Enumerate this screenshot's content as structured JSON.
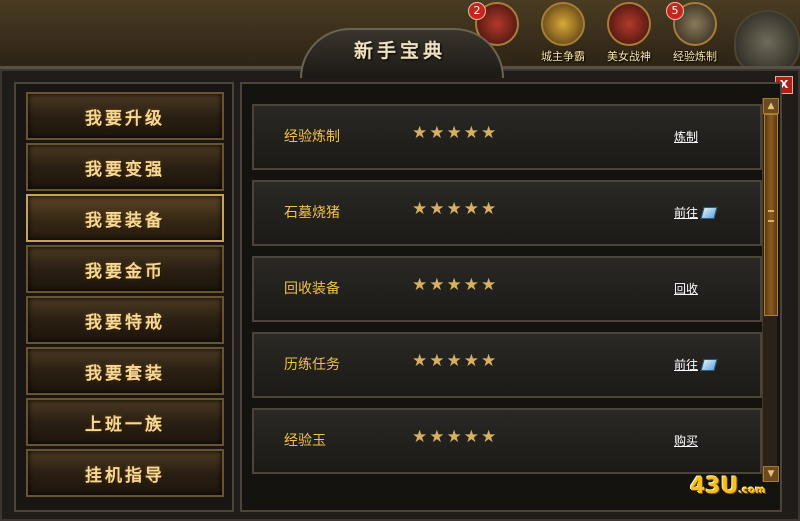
{
  "title": "新手宝典",
  "close_label": "X",
  "top_icons": [
    {
      "label": "",
      "badge": "2",
      "icon": "helmet-icon",
      "style": "red"
    },
    {
      "label": "城主争霸",
      "badge": "",
      "icon": "crown-helmet-icon",
      "style": "gold"
    },
    {
      "label": "美女战神",
      "badge": "",
      "icon": "warrior-woman-icon",
      "style": "red"
    },
    {
      "label": "经验炼制",
      "badge": "5",
      "icon": "cauldron-icon",
      "style": "stone"
    }
  ],
  "nav": [
    {
      "label": "我要升级"
    },
    {
      "label": "我要变强"
    },
    {
      "label": "我要装备",
      "active": true
    },
    {
      "label": "我要金币"
    },
    {
      "label": "我要特戒"
    },
    {
      "label": "我要套装"
    },
    {
      "label": "上班一族"
    },
    {
      "label": "挂机指导"
    }
  ],
  "rows": [
    {
      "name": "经验炼制",
      "stars": "★★★★★",
      "action": "炼制",
      "gem": false
    },
    {
      "name": "石墓烧猪",
      "stars": "★★★★★",
      "action": "前往",
      "gem": true
    },
    {
      "name": "回收装备",
      "stars": "★★★★★",
      "action": "回收",
      "gem": false
    },
    {
      "name": "历练任务",
      "stars": "★★★★★",
      "action": "前往",
      "gem": true
    },
    {
      "name": "经验玉",
      "stars": "★★★★★",
      "action": "购买",
      "gem": false
    }
  ],
  "logo": {
    "main": "43U",
    "suffix": ".com"
  }
}
